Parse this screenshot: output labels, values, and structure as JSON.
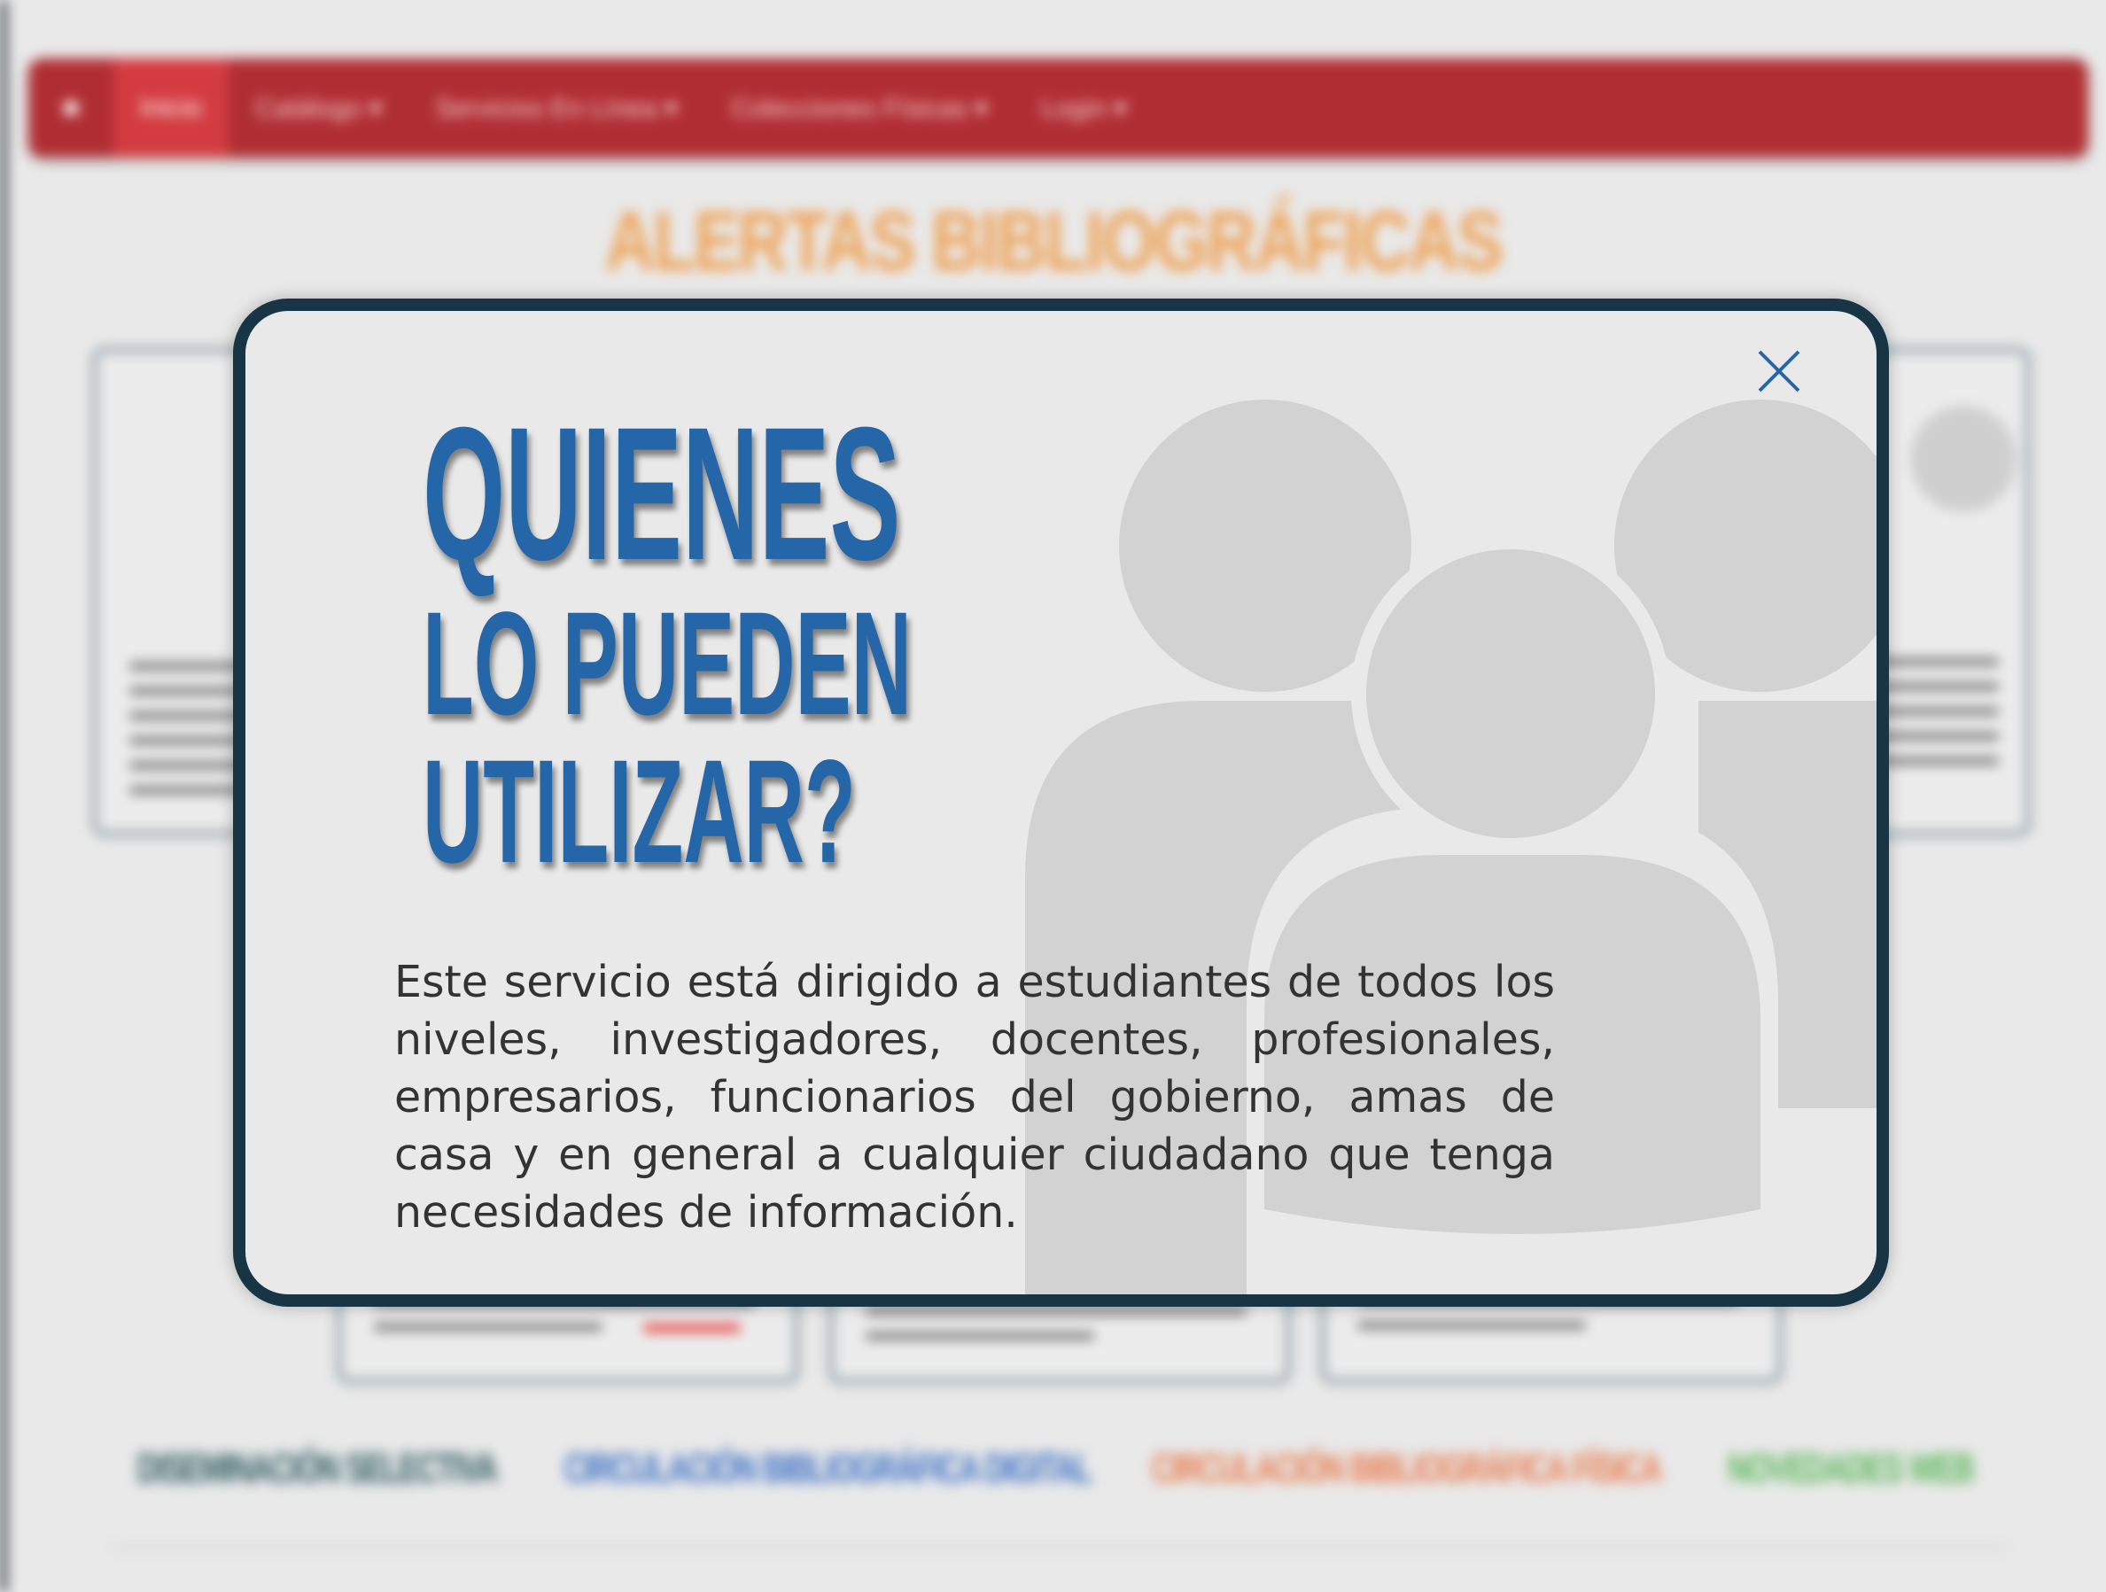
{
  "nav": {
    "items": [
      {
        "label": "Inicio",
        "active": true
      },
      {
        "label": "Catálogo ▾",
        "active": false
      },
      {
        "label": "Servicios En Línea ▾",
        "active": false
      },
      {
        "label": "Colecciones Físicas ▾",
        "active": false
      },
      {
        "label": "Login ▾",
        "active": false
      }
    ]
  },
  "page": {
    "heading": "ALERTAS BIBLIOGRÁFICAS"
  },
  "bottom_links": [
    {
      "label": "DISEMINACIÓN SELECTIVA",
      "color": "#2e5b62"
    },
    {
      "label": "CIRCULACIÓN BIBLIOGRÁFICA DIGITAL",
      "color": "#3b6fc4"
    },
    {
      "label": "CIRCULACIÓN BIBLIOGRÁFICA FÍSICA",
      "color": "#e87a4d"
    },
    {
      "label": "NOVEDADES WEB",
      "color": "#5bb65a"
    }
  ],
  "modal": {
    "heading_line1": "QUIENES",
    "heading_line2": "LO PUEDEN",
    "heading_line3": "UTILIZAR?",
    "body": "Este servicio está dirigido a estudiantes de todos los niveles, investigadores, docentes, profesionales, empresarios, funcionarios del gobierno, amas de casa y en general a cualquier ciudadano que tenga necesidades de información.",
    "close_icon": "close-icon",
    "accent_color": "#2566a8",
    "border_color": "#173545"
  }
}
